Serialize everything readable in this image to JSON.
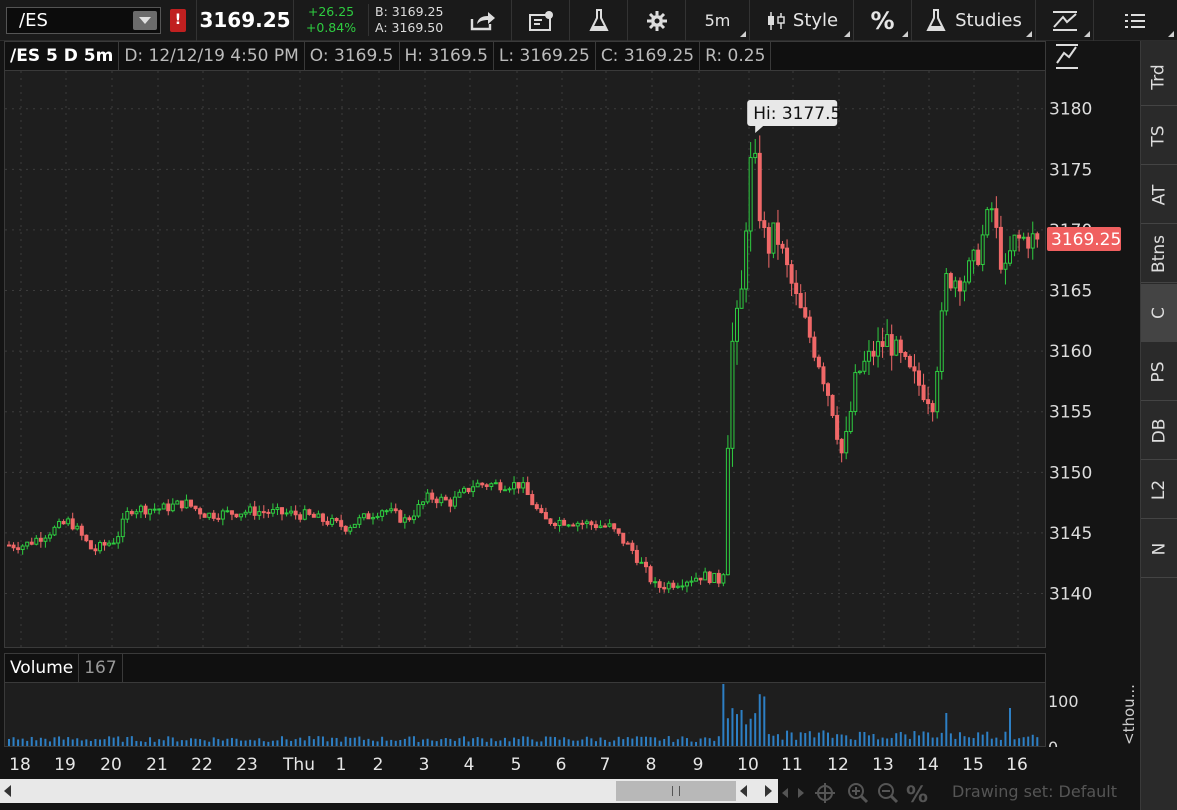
{
  "toolbar": {
    "symbol": "/ES",
    "alert_badge": "!",
    "last_price": "3169.25",
    "change_abs": "+26.25",
    "change_pct": "+0.84%",
    "bid": "B: 3169.25",
    "ask": "A: 3169.50",
    "timeframe": "5m",
    "style_label": "Style",
    "percent_label": "%",
    "studies_label": "Studies"
  },
  "chart_header": {
    "symbol": "/ES 5 D 5m",
    "date": "D: 12/12/19 4:50 PM",
    "open": "O: 3169.5",
    "high": "H: 3169.5",
    "low": "L: 3169.25",
    "close": "C: 3169.25",
    "range": "R: 0.25"
  },
  "volume_header": {
    "label": "Volume",
    "value": "167"
  },
  "hi_label": "Hi: 3177.5",
  "price_label": "3169.25",
  "right_panel_tabs": [
    "Trd",
    "TS",
    "AT",
    "Btns",
    "C",
    "PS",
    "DB",
    "L2",
    "N"
  ],
  "right_panel_active": "C",
  "volume_axis": {
    "tick": "100",
    "zero": "0",
    "unit": "<thou..."
  },
  "bottom_bar": {
    "drawing_set": "Drawing set: Default",
    "percent": "%"
  },
  "colors": {
    "up": "#2ecc40",
    "down": "#f06868",
    "price_tag": "#f06060",
    "bg": "#1e1e1e"
  },
  "chart_data": {
    "type": "candlestick",
    "price_ticks": [
      3140,
      3145,
      3150,
      3155,
      3160,
      3165,
      3170,
      3175,
      3180
    ],
    "ylim": [
      3136,
      3184
    ],
    "time_labels": [
      "18",
      "19",
      "20",
      "21",
      "22",
      "23",
      "Thu",
      "1",
      "2",
      "3",
      "4",
      "5",
      "6",
      "7",
      "8",
      "9",
      "10",
      "11",
      "12",
      "13",
      "14",
      "15",
      "16"
    ],
    "path": [
      {
        "t": "18",
        "price": 3144.0
      },
      {
        "t": "19",
        "price": 3146.0
      },
      {
        "t": "19.5",
        "price": 3143.5
      },
      {
        "t": "20",
        "price": 3144.5
      },
      {
        "t": "20.3",
        "price": 3147.0
      },
      {
        "t": "21",
        "price": 3147.0
      },
      {
        "t": "21.5",
        "price": 3147.5
      },
      {
        "t": "22",
        "price": 3146.5
      },
      {
        "t": "23",
        "price": 3146.8
      },
      {
        "t": "Thu",
        "price": 3146.5
      },
      {
        "t": "1",
        "price": 3145.5
      },
      {
        "t": "2",
        "price": 3147.0
      },
      {
        "t": "2.5",
        "price": 3146.0
      },
      {
        "t": "3",
        "price": 3148.0
      },
      {
        "t": "3.5",
        "price": 3147.5
      },
      {
        "t": "4",
        "price": 3149.0
      },
      {
        "t": "5",
        "price": 3149.0
      },
      {
        "t": "5.5",
        "price": 3146.0
      },
      {
        "t": "6",
        "price": 3146.0
      },
      {
        "t": "7",
        "price": 3145.5
      },
      {
        "t": "7.5",
        "price": 3143.5
      },
      {
        "t": "8",
        "price": 3140.5
      },
      {
        "t": "8.5",
        "price": 3141.0
      },
      {
        "t": "9",
        "price": 3141.5
      },
      {
        "t": "9.4",
        "price": 3141.0
      },
      {
        "t": "9.55",
        "price": 3160.0
      },
      {
        "t": "9.75",
        "price": 3163.0
      },
      {
        "t": "9.9",
        "price": 3174.0
      },
      {
        "t": "10",
        "price": 3176.0
      },
      {
        "t": "10.3",
        "price": 3168.0
      },
      {
        "t": "10.5",
        "price": 3170.0
      },
      {
        "t": "11",
        "price": 3164.0
      },
      {
        "t": "11.5",
        "price": 3159.0
      },
      {
        "t": "11.8",
        "price": 3155.0
      },
      {
        "t": "12",
        "price": 3151.0
      },
      {
        "t": "12.3",
        "price": 3158.0
      },
      {
        "t": "12.7",
        "price": 3160.0
      },
      {
        "t": "13",
        "price": 3161.0
      },
      {
        "t": "13.5",
        "price": 3158.0
      },
      {
        "t": "14",
        "price": 3156.0
      },
      {
        "t": "14.3",
        "price": 3166.0
      },
      {
        "t": "14.7",
        "price": 3166.0
      },
      {
        "t": "15",
        "price": 3168.0
      },
      {
        "t": "15.3",
        "price": 3172.0
      },
      {
        "t": "15.6",
        "price": 3166.0
      },
      {
        "t": "15.8",
        "price": 3169.0
      },
      {
        "t": "16",
        "price": 3169.25
      }
    ],
    "hi": 3177.5,
    "lo": 3137.5
  }
}
